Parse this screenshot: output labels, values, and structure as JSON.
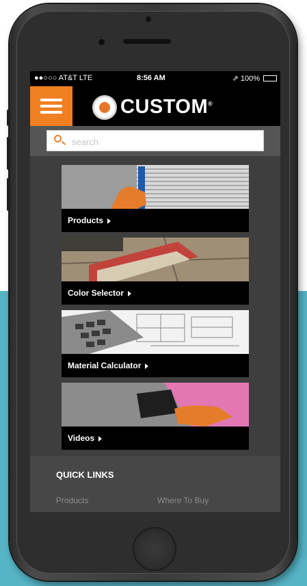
{
  "status_bar": {
    "carrier": "●●○○○ AT&T  LTE",
    "time": "8:56 AM",
    "battery": "⇗ 100%"
  },
  "header": {
    "logo_text": "CUSTOM",
    "logo_mark": "®"
  },
  "search": {
    "placeholder": "search",
    "value": ""
  },
  "tiles": [
    {
      "label": "Products",
      "image": "trowel-on-tile-photo"
    },
    {
      "label": "Color Selector",
      "image": "grout-float-photo"
    },
    {
      "label": "Material Calculator",
      "image": "calculator-blueprint-photo"
    },
    {
      "label": "Videos",
      "image": "squeegee-membrane-photo"
    }
  ],
  "quick_links": {
    "title": "QUICK LINKS",
    "items": [
      "Products",
      "Where To Buy"
    ]
  },
  "colors": {
    "accent": "#f07f22",
    "background_teal": "#56b4c6",
    "screen_bg": "#3e3e3e"
  }
}
